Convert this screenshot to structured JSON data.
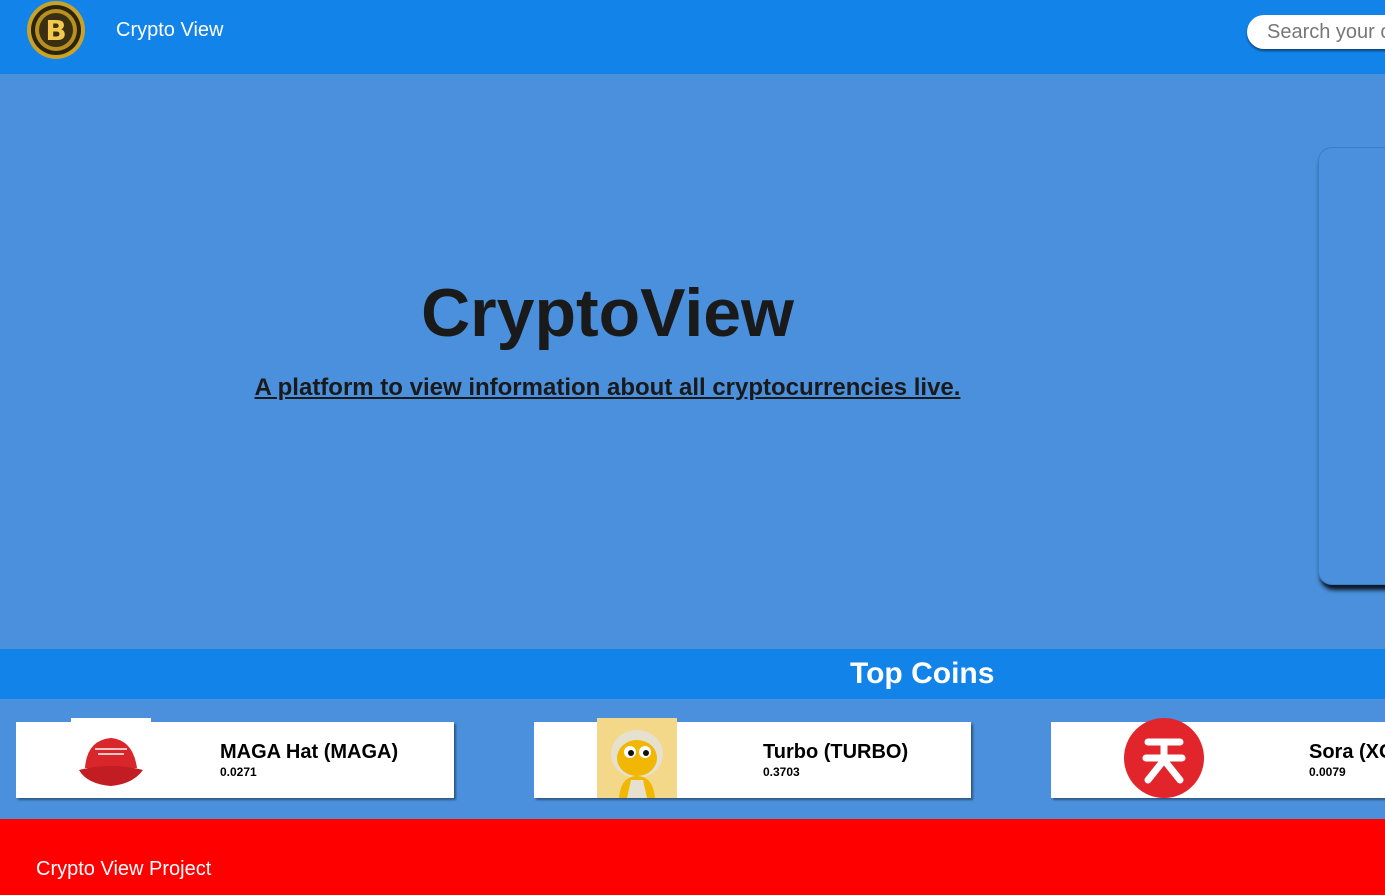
{
  "nav": {
    "logo_icon": "bitcoin-logo-icon",
    "brand": "Crypto View",
    "search_placeholder": "Search your c"
  },
  "hero": {
    "title": "CryptoView",
    "subtitle": "A platform to view information about all cryptocurrencies live."
  },
  "top_coins": {
    "heading": "Top Coins",
    "coins": [
      {
        "name": "MAGA Hat (MAGA)",
        "price": "0.0271",
        "icon": "red-maga-hat-icon"
      },
      {
        "name": "Turbo (TURBO)",
        "price": "0.3703",
        "icon": "turbo-frog-icon"
      },
      {
        "name": "Sora (XO",
        "price": "0.0079",
        "icon": "sora-red-circle-icon"
      }
    ]
  },
  "footer": {
    "text": "Crypto View Project"
  },
  "colors": {
    "nav_bg": "#1283e8",
    "hero_bg": "#4a90dc",
    "footer_bg": "#ff0000",
    "card_bg": "#ffffff"
  }
}
